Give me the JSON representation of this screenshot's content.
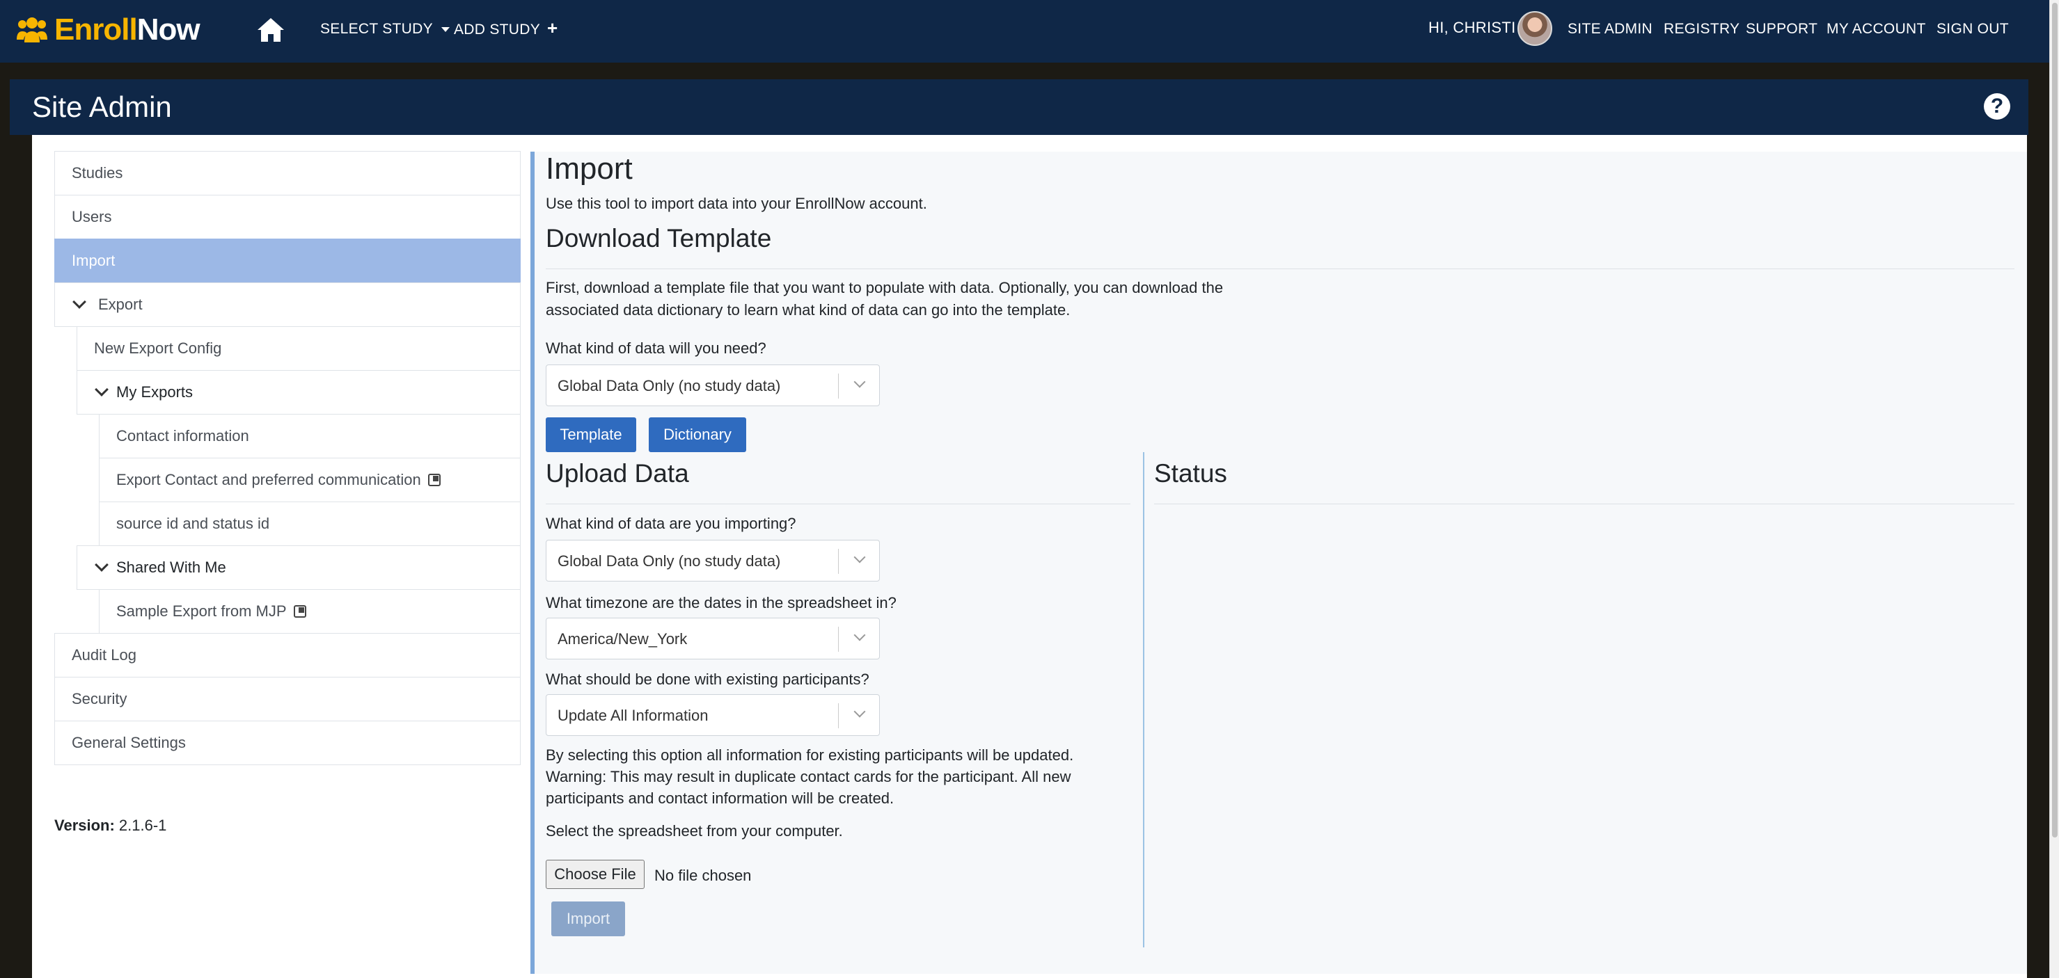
{
  "navbar": {
    "brand_part1": "Enroll",
    "brand_part2": "Now",
    "select_study": "SELECT STUDY",
    "add_study": "ADD STUDY",
    "greeting": "HI, CHRISTI",
    "site_admin": "SITE ADMIN",
    "registry": "REGISTRY",
    "support": "SUPPORT",
    "my_account": "MY ACCOUNT",
    "sign_out": "SIGN OUT"
  },
  "header": {
    "title": "Site Admin",
    "help_icon": "?"
  },
  "sidebar": {
    "studies": "Studies",
    "users": "Users",
    "import": "Import",
    "export": "Export",
    "new_export_config": "New Export Config",
    "my_exports": "My Exports",
    "my_exports_items": [
      "Contact information",
      "Export Contact and preferred communication",
      "source id and status id"
    ],
    "shared_with_me": "Shared With Me",
    "shared_items": [
      "Sample Export from MJP"
    ],
    "audit_log": "Audit Log",
    "security": "Security",
    "general_settings": "General Settings",
    "version_label": "Version:",
    "version_value": " 2.1.6-1"
  },
  "main": {
    "title": "Import",
    "intro": "Use this tool to import data into your EnrollNow account.",
    "download": {
      "heading": "Download Template",
      "description": "First, download a template file that you want to populate with data. Optionally, you can download the associated data dictionary to learn what kind of data can go into the template.",
      "data_kind_label": "What kind of data will you need?",
      "data_kind_value": "Global Data Only (no study data)",
      "template_button": "Template",
      "dictionary_button": "Dictionary"
    },
    "upload": {
      "heading": "Upload Data",
      "data_kind_label": "What kind of data are you importing?",
      "data_kind_value": "Global Data Only (no study data)",
      "timezone_label": "What timezone are the dates in the spreadsheet in?",
      "timezone_value": "America/New_York",
      "existing_label": "What should be done with existing participants?",
      "existing_value": "Update All Information",
      "warning_line1": "By selecting this option all information for existing participants will be updated.",
      "warning_line2": "Warning: This may result in duplicate contact cards for the participant. All new participants and contact information will be created.",
      "select_file_label": "Select the spreadsheet from your computer.",
      "choose_file_button": "Choose File",
      "file_status": "No file chosen",
      "import_button": "Import"
    },
    "status": {
      "heading": "Status"
    }
  },
  "colors": {
    "navbar_bg": "#0f2747",
    "brand_accent": "#f7b500",
    "active_item": "#9cb8e6",
    "primary_button": "#2f6bbf"
  }
}
